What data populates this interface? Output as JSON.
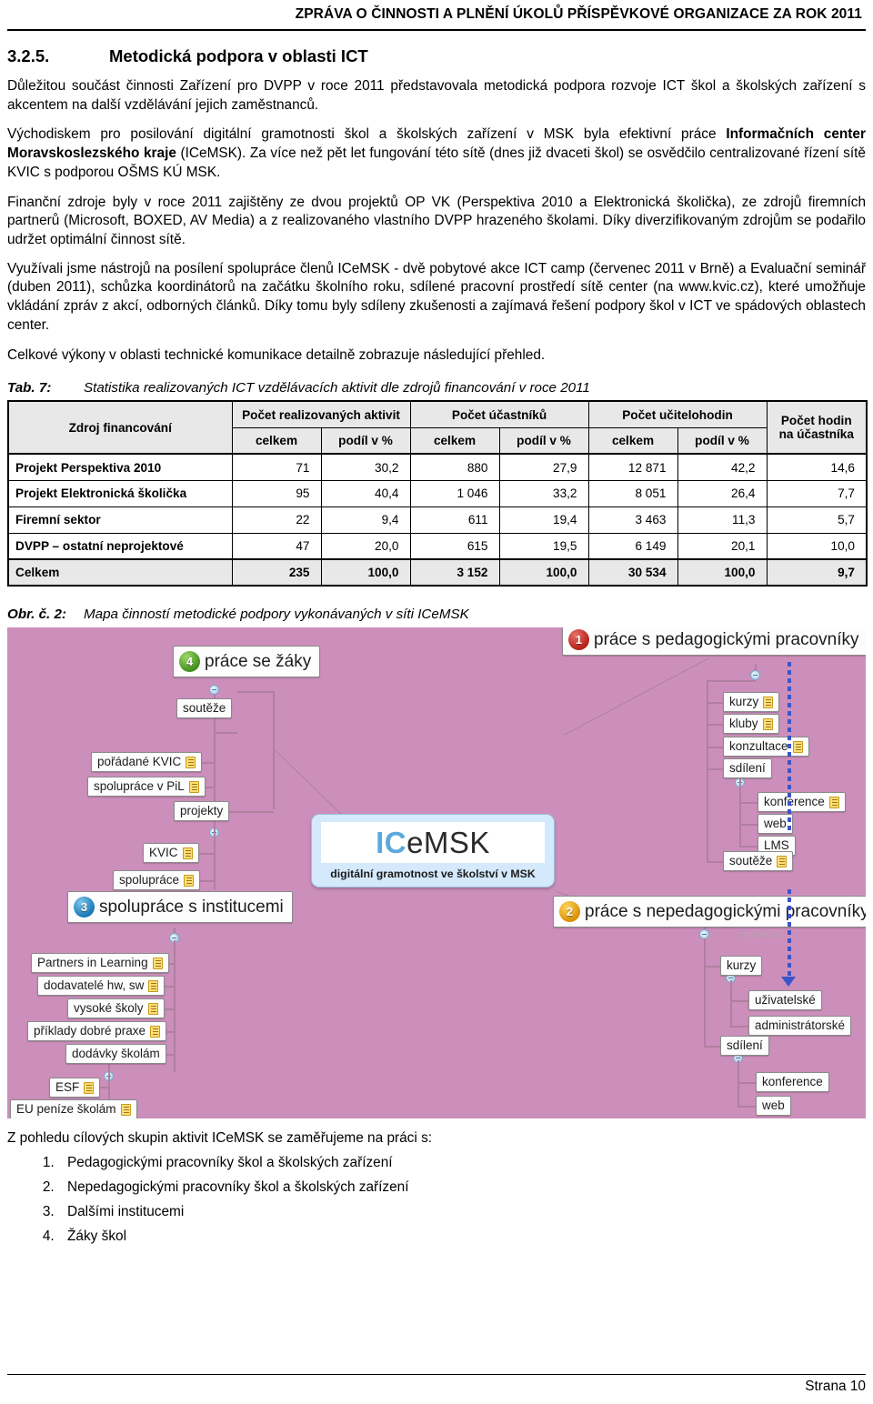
{
  "header": {
    "running_title": "ZPRÁVA O ČINNOSTI A PLNĚNÍ ÚKOLŮ PŘÍSPĚVKOVÉ ORGANIZACE ZA ROK 2011"
  },
  "section": {
    "number": "3.2.5.",
    "title": "Metodická podpora v oblasti ICT"
  },
  "paragraphs": {
    "p1": "Důležitou součást činnosti Zařízení pro DVPP v roce 2011 představovala metodická podpora rozvoje ICT škol a školských zařízení s akcentem na další vzdělávání jejich zaměstnanců.",
    "p2_a": "Východiskem pro posilování digitální gramotnosti škol a školských zařízení v MSK byla efektivní práce ",
    "p2_b": "Informačních center Moravskoslezského kraje",
    "p2_c": " (ICeMSK). Za více než pět let fungování této sítě (dnes již dvaceti škol) se osvědčilo centralizované řízení sítě KVIC s podporou OŠMS KÚ MSK.",
    "p3": "Finanční zdroje byly v roce 2011 zajištěny ze dvou projektů OP VK (Perspektiva 2010 a Elektronická školička), ze zdrojů firemních partnerů (Microsoft, BOXED, AV Media) a z realizovaného vlastního DVPP hrazeného školami. Díky diverzifikovaným zdrojům se podařilo udržet optimální činnost sítě.",
    "p4": "Využívali jsme nástrojů na posílení spolupráce členů ICeMSK - dvě pobytové akce ICT camp (červenec 2011 v Brně) a Evaluační seminář (duben 2011), schůzka koordinátorů na začátku školního roku, sdílené pracovní prostředí sítě center (na www.kvic.cz), které umožňuje vkládání zpráv z akcí, odborných článků. Díky tomu byly sdíleny zkušenosti a zajímavá řešení podpory škol v ICT ve spádových oblastech center.",
    "p5": "Celkové výkony v oblasti technické komunikace detailně zobrazuje následující přehled."
  },
  "table_caption": {
    "label": "Tab. 7:",
    "text": "Statistika realizovaných ICT vzdělávacích aktivit dle zdrojů financování v roce 2011"
  },
  "table": {
    "group_headers": [
      "Zdroj financování",
      "Počet realizovaných aktivit",
      "Počet účastníků",
      "Počet učitelohodin",
      "Počet hodin na účastníka"
    ],
    "sub_headers": [
      "celkem",
      "podíl v %",
      "celkem",
      "podíl v %",
      "celkem",
      "podíl v %"
    ],
    "rows": [
      {
        "label": "Projekt Perspektiva 2010",
        "cells": [
          "71",
          "30,2",
          "880",
          "27,9",
          "12 871",
          "42,2",
          "14,6"
        ]
      },
      {
        "label": "Projekt Elektronická školička",
        "cells": [
          "95",
          "40,4",
          "1 046",
          "33,2",
          "8 051",
          "26,4",
          "7,7"
        ]
      },
      {
        "label": "Firemní sektor",
        "cells": [
          "22",
          "9,4",
          "611",
          "19,4",
          "3 463",
          "11,3",
          "5,7"
        ]
      },
      {
        "label": "DVPP –  ostatní neprojektové",
        "cells": [
          "47",
          "20,0",
          "615",
          "19,5",
          "6 149",
          "20,1",
          "10,0"
        ]
      }
    ],
    "total_row": {
      "label": "Celkem",
      "cells": [
        "235",
        "100,0",
        "3 152",
        "100,0",
        "30 534",
        "100,0",
        "9,7"
      ]
    }
  },
  "figure_caption": {
    "label": "Obr. č. 2:",
    "text": "Mapa činností metodické podpory vykonávaných v síti ICeMSK"
  },
  "figure": {
    "background_color": "#cc8fbb",
    "center": {
      "logo_prefix": "IC",
      "logo_suffix": "eMSK",
      "subtitle": "digitální gramotnost ve školství v MSK"
    },
    "branch_1": {
      "badge": "1",
      "title": "práce s pedagogickými pracovníky",
      "children": [
        "kurzy",
        "kluby",
        "konzultace",
        "sdílení"
      ],
      "grandchildren": [
        "konference",
        "web",
        "LMS"
      ],
      "extra": "soutěže"
    },
    "branch_2": {
      "badge": "2",
      "title": "práce s nepedagogickými pracovníky",
      "children": [
        "kurzy",
        "sdílení"
      ],
      "kurzy_children": [
        "uživatelské",
        "administrátorské"
      ],
      "sdileni_children": [
        "konference",
        "web"
      ]
    },
    "branch_3": {
      "badge": "3",
      "title": "spolupráce s institucemi",
      "children": [
        "Partners in Learning",
        "dodavatelé hw, sw",
        "vysoké školy",
        "příklady dobré praxe",
        "dodávky školám"
      ],
      "grandchildren": [
        "ESF",
        "EU peníze školám"
      ]
    },
    "branch_4": {
      "badge": "4",
      "title": "práce se žáky",
      "children": [
        "soutěže",
        "projekty"
      ],
      "soutez_children": [
        "pořádané KVIC",
        "spolupráce v PiL"
      ],
      "projekty_children": [
        "KVIC",
        "spolupráce"
      ]
    },
    "annotation": "společná"
  },
  "target_groups": {
    "lead": "Z pohledu cílových skupin aktivit ICeMSK se zaměřujeme na práci s:",
    "items": [
      "Pedagogickými pracovníky škol a školských zařízení",
      "Nepedagogickými pracovníky škol a školských zařízení",
      "Dalšími institucemi",
      "Žáky škol"
    ]
  },
  "footer": {
    "page_label": "Strana 10"
  }
}
